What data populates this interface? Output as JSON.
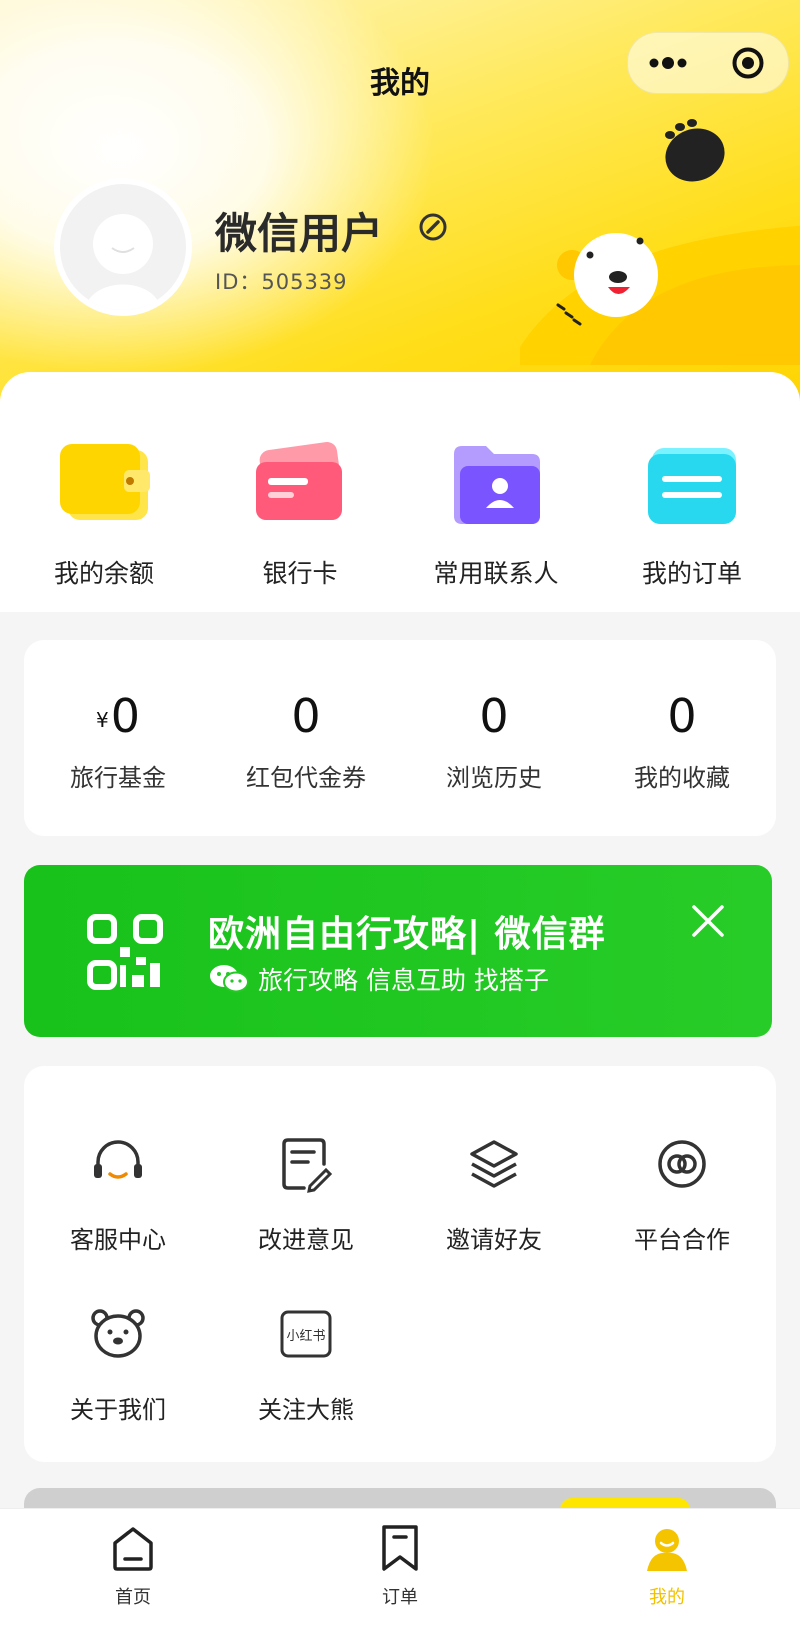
{
  "header": {
    "title": "我的"
  },
  "profile": {
    "username": "微信用户",
    "id_text": "ID：505339"
  },
  "quick_actions": [
    {
      "label": "我的余额",
      "icon": "wallet-icon"
    },
    {
      "label": "银行卡",
      "icon": "bank-card-icon"
    },
    {
      "label": "常用联系人",
      "icon": "contacts-folder-icon"
    },
    {
      "label": "我的订单",
      "icon": "order-card-icon"
    }
  ],
  "stats": [
    {
      "value": "0",
      "prefix": "¥",
      "label": "旅行基金"
    },
    {
      "value": "0",
      "prefix": "",
      "label": "红包代金券"
    },
    {
      "value": "0",
      "prefix": "",
      "label": "浏览历史"
    },
    {
      "value": "0",
      "prefix": "",
      "label": "我的收藏"
    }
  ],
  "banner": {
    "title": "欧洲自由行攻略| 微信群",
    "subtitle": "旅行攻略 信息互助 找搭子",
    "color": "#1fc21f"
  },
  "tools": [
    {
      "label": "客服中心",
      "icon": "headset-icon"
    },
    {
      "label": "改进意见",
      "icon": "feedback-icon"
    },
    {
      "label": "邀请好友",
      "icon": "layers-icon"
    },
    {
      "label": "平台合作",
      "icon": "link-icon"
    },
    {
      "label": "关于我们",
      "icon": "bear-icon"
    },
    {
      "label": "关注大熊",
      "icon": "xiaohongshu-icon",
      "icon_text": "小红书"
    }
  ],
  "tabbar": [
    {
      "label": "首页",
      "icon": "home-icon",
      "active": false
    },
    {
      "label": "订单",
      "icon": "bookmark-icon",
      "active": false
    },
    {
      "label": "我的",
      "icon": "profile-icon",
      "active": true
    }
  ],
  "colors": {
    "accent": "#ffd800",
    "tab_active": "#f2c200",
    "banner_green": "#1fc21f"
  }
}
